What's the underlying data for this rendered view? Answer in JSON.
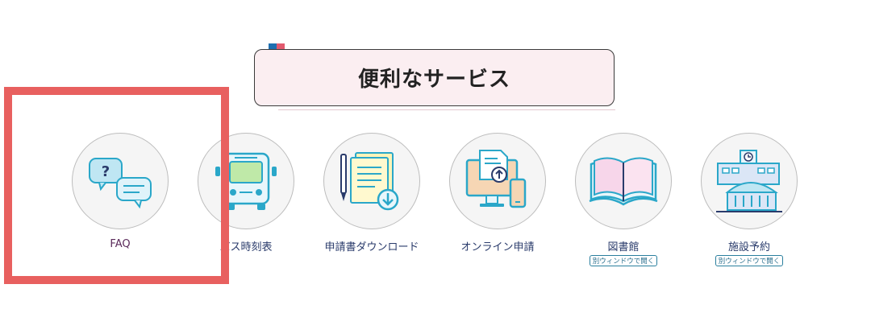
{
  "section": {
    "title": "便利なサービス"
  },
  "services": [
    {
      "label": "FAQ",
      "icon": "faq-chat-bubbles-icon"
    },
    {
      "label": "バス時刻表",
      "icon": "bus-icon"
    },
    {
      "label": "申請書ダウンロード",
      "icon": "document-download-icon"
    },
    {
      "label": "オンライン申請",
      "icon": "online-application-devices-icon"
    },
    {
      "label": "図書館",
      "icon": "open-book-icon",
      "badge": "別ウィンドウで開く"
    },
    {
      "label": "施設予約",
      "icon": "facility-building-icon",
      "badge": "別ウィンドウで開く"
    }
  ],
  "colors": {
    "title_background": "#fbeef1",
    "highlight_border": "#e8605f",
    "label_text": "#2a3b6b",
    "icon_accent": "#2aa7c9"
  }
}
